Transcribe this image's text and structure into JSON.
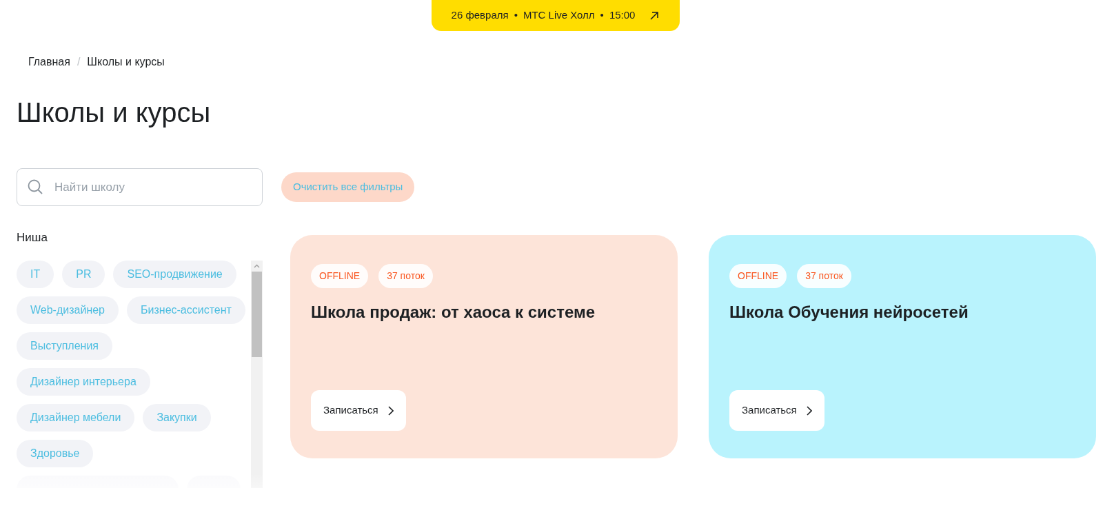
{
  "banner": {
    "date": "26 февраля",
    "sep_1": "•",
    "venue": "МТС Live Холл",
    "sep_2": "•",
    "time": "15:00"
  },
  "breadcrumb_separator": "/",
  "breadcrumbs": [
    {
      "label": "Главная"
    },
    {
      "label": "Школы и курсы"
    }
  ],
  "page_title": "Школы и курсы",
  "search": {
    "placeholder": "Найти школу"
  },
  "clear_filters": "Очистить все фильтры",
  "filter": {
    "title": "Ниша",
    "chips": [
      {
        "label": "IT"
      },
      {
        "label": "PR"
      },
      {
        "label": "SEO-продвижение"
      },
      {
        "label": "Web-дизайнер"
      },
      {
        "label": "Бизнес-ассистент"
      },
      {
        "label": "Выступления"
      },
      {
        "label": "Дизайнер интерьера"
      },
      {
        "label": "Дизайнер мебели"
      },
      {
        "label": "Закупки"
      },
      {
        "label": "Здоровье"
      }
    ]
  },
  "cards": [
    {
      "color": "#fde4d9",
      "tags": [
        "OFFLINE",
        "37 поток"
      ],
      "title": "Школа продаж: от хаоса к системе",
      "button": "Записаться"
    },
    {
      "color": "#b9f3fd",
      "tags": [
        "OFFLINE",
        "37 поток"
      ],
      "title": "Школа Обучения нейросетей",
      "button": "Записаться"
    }
  ]
}
